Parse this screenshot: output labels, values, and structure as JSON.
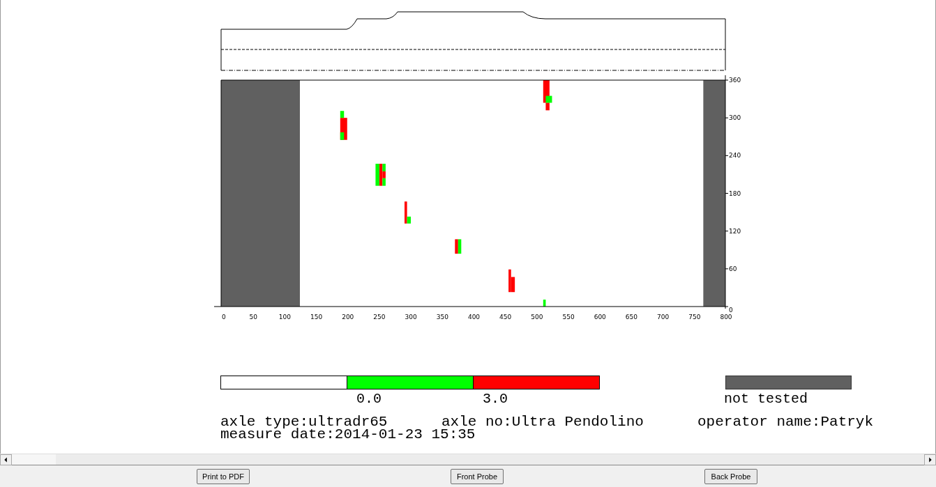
{
  "defect_map": {
    "x_ticks": [
      "0",
      "50",
      "100",
      "150",
      "200",
      "250",
      "300",
      "350",
      "400",
      "450",
      "500",
      "550",
      "600",
      "650",
      "700",
      "750",
      "800"
    ],
    "y_ticks": [
      "360",
      "300",
      "240",
      "180",
      "120",
      "60",
      "0"
    ],
    "series": [
      {
        "color": "#ff0000"
      },
      {
        "color": "#00ff00"
      }
    ]
  },
  "scale": {
    "segments": [
      {
        "color": "#00ff00"
      },
      {
        "color": "#ff0000"
      }
    ],
    "labels": [
      "0.0",
      "3.0"
    ]
  },
  "not_tested": {
    "color": "#606060",
    "label": "not tested"
  },
  "info": {
    "row": [
      "axle type:ultradr65",
      "axle no:Ultra Pendolino",
      "operator name:Patryk"
    ],
    "date": "measure date:2014-01-23 15:35"
  },
  "buttons": [
    "Print to PDF",
    "Front Probe",
    "Back Probe"
  ]
}
